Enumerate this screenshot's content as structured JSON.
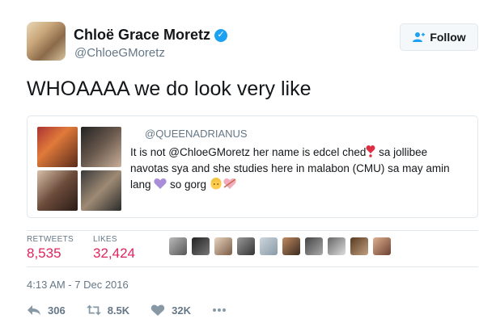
{
  "profile": {
    "name": "Chloë Grace Moretz",
    "handle": "@ChloeGMoretz",
    "follow_label": "Follow"
  },
  "tweet": {
    "text": "WHOAAAA we do look very like"
  },
  "quote": {
    "handle": "@QUEENADRIANUS",
    "text_part1": "It is not @ChloeGMoretz her name is edcel ched",
    "text_part2": " sa jollibee navotas sya and she studies here in malabon (CMU) sa may amin lang ",
    "text_part3": " so gorg "
  },
  "stats": {
    "retweets_label": "RETWEETS",
    "retweets_value": "8,535",
    "likes_label": "LIKES",
    "likes_value": "32,424"
  },
  "timestamp": "4:13 AM - 7 Dec 2016",
  "actions": {
    "reply_count": "306",
    "retweet_count": "8.5K",
    "like_count": "32K"
  },
  "colors": {
    "accent": "#1da1f2",
    "likes": "#e0245e",
    "muted": "#657786",
    "border": "#e1e8ed"
  }
}
